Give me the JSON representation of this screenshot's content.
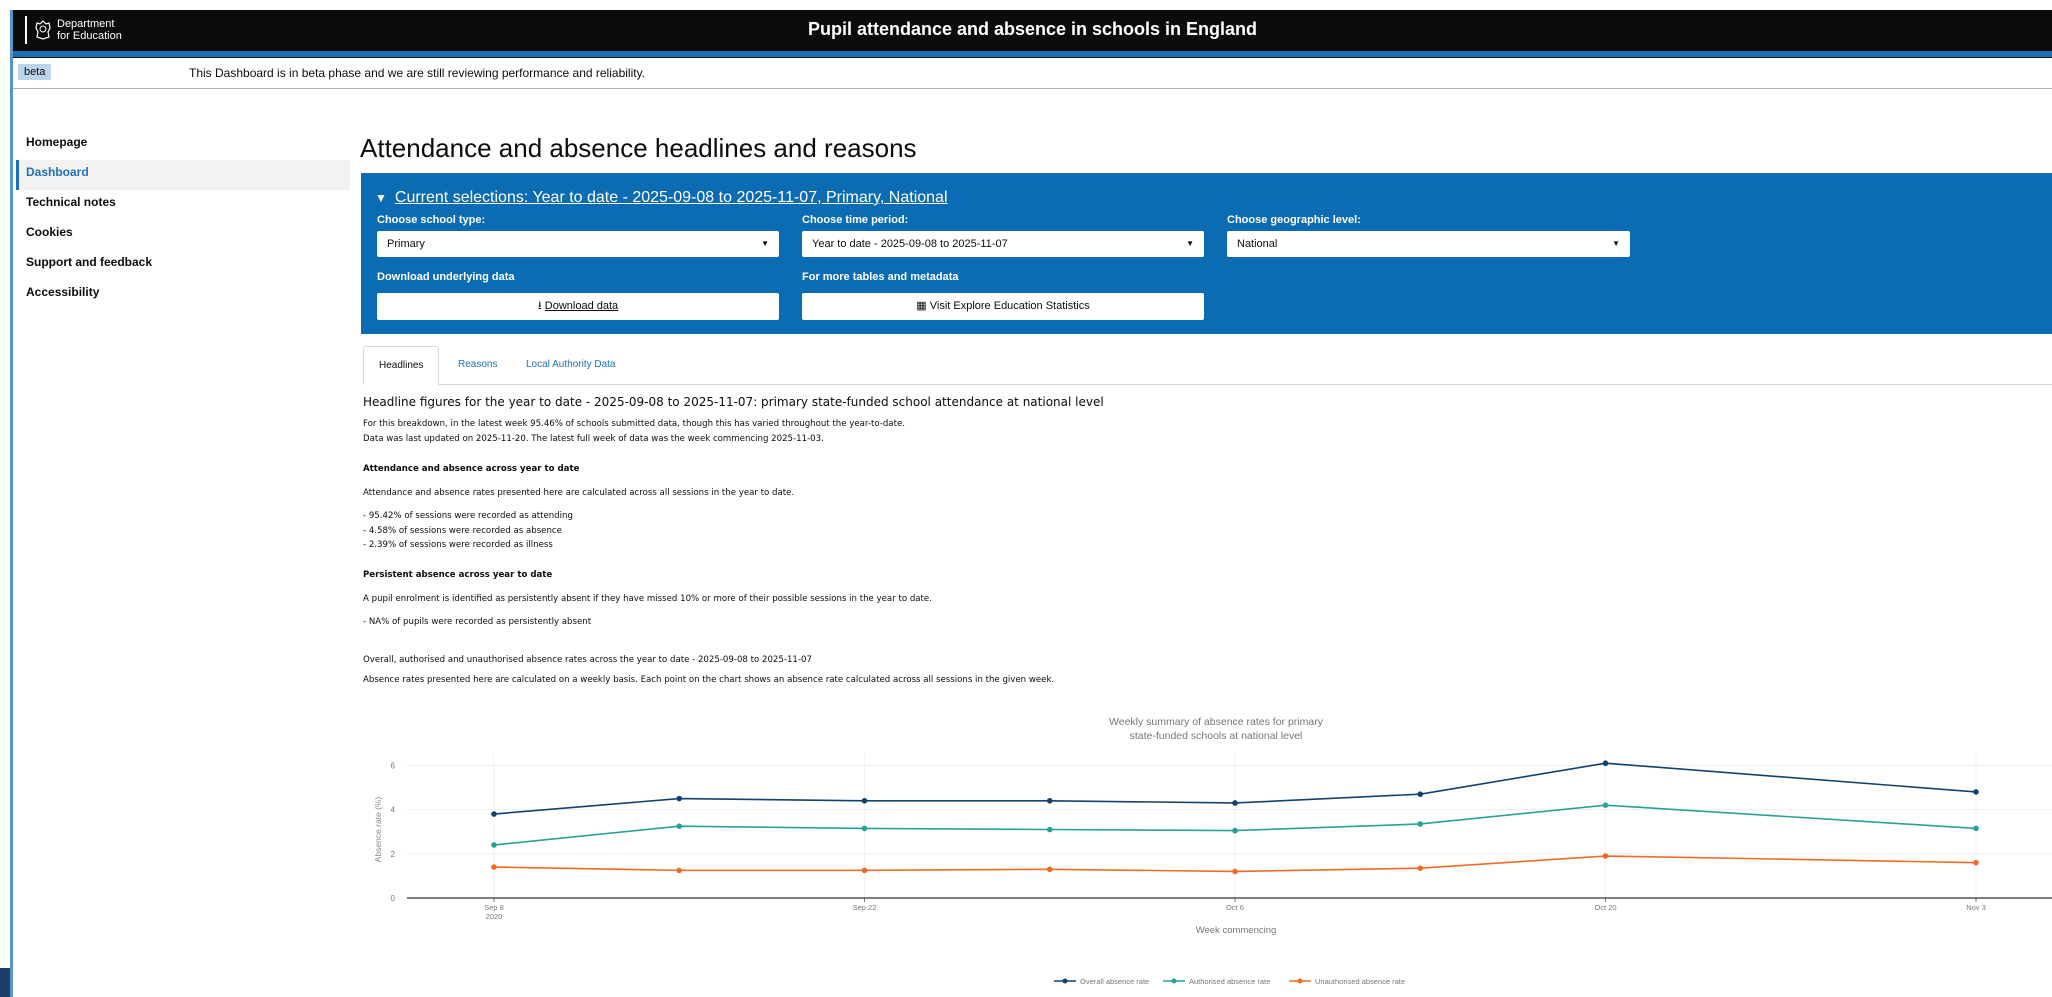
{
  "header": {
    "logo_line1": "Department",
    "logo_line2": "for Education",
    "title": "Pupil attendance and absence in schools in England"
  },
  "beta": {
    "tag": "beta",
    "message": "This Dashboard is in beta phase and we are still reviewing performance and reliability."
  },
  "nav": {
    "items": [
      {
        "label": "Homepage"
      },
      {
        "label": "Dashboard",
        "active": true
      },
      {
        "label": "Technical notes"
      },
      {
        "label": "Cookies"
      },
      {
        "label": "Support and feedback"
      },
      {
        "label": "Accessibility"
      }
    ]
  },
  "page": {
    "title": "Attendance and absence headlines and reasons"
  },
  "selections": {
    "summary": "Current selections: Year to date - 2025-09-08 to 2025-11-07, Primary, National",
    "school_type_label": "Choose school type:",
    "school_type_value": "Primary",
    "time_period_label": "Choose time period:",
    "time_period_value": "Year to date - 2025-09-08 to 2025-11-07",
    "geo_level_label": "Choose geographic level:",
    "geo_level_value": "National",
    "download_label": "Download underlying data",
    "download_button": "Download data",
    "more_tables_label": "For more tables and metadata",
    "explore_button": "Visit Explore Education Statistics",
    "accent_color": "#0b6cb4"
  },
  "tabs": [
    {
      "label": "Headlines",
      "active": true
    },
    {
      "label": "Reasons"
    },
    {
      "label": "Local Authority Data"
    }
  ],
  "headlines": {
    "heading": "Headline figures for the year to date - 2025-09-08 to 2025-11-07: primary state-funded school attendance at national level",
    "breakdown_note": "For this breakdown, in the latest week 95.46% of schools submitted data, though this has varied throughout the year-to-date.",
    "updated_note": "Data was last updated on 2025-11-20. The latest full week of data was the week commencing 2025-11-03.",
    "attendance_heading": "Attendance and absence across year to date",
    "attendance_desc": "Attendance and absence rates presented here are calculated across all sessions in the year to date.",
    "attending": "- 95.42% of sessions were recorded as attending",
    "absence": "- 4.58% of sessions were recorded as absence",
    "illness": "- 2.39% of sessions were recorded as illness",
    "persistent_heading": "Persistent absence across year to date",
    "persistent_desc": "A pupil enrolment is identified as persistently absent if they have missed 10% or more of their possible sessions in the year to date.",
    "persistent_value": "- NA% of pupils were recorded as persistently absent",
    "rates_heading": "Overall, authorised and unauthorised absence rates across the year to date - 2025-09-08 to 2025-11-07",
    "rates_desc": "Absence rates presented here are calculated on a weekly basis. Each point on the chart shows an absence rate calculated across all sessions in the given week."
  },
  "chart_data": {
    "type": "line",
    "title_line1": "Weekly summary of absence rates for primary",
    "title_line2": "state-funded schools at national level",
    "xlabel": "Week commencing",
    "ylabel": "Absence rate (%)",
    "x": [
      "2025-09-08",
      "2025-09-15",
      "2025-09-22",
      "2025-09-29",
      "2025-10-06",
      "2025-10-13",
      "2025-10-20",
      "2025-11-03"
    ],
    "x_ticks": [
      "Sep 8",
      "Sep 22",
      "Oct 6",
      "Oct 20",
      "Nov 3"
    ],
    "x_tick_dates": [
      "2025-09-08",
      "2025-09-22",
      "2025-10-06",
      "2025-10-20",
      "2025-11-03"
    ],
    "x_tick_sub": "2020",
    "y_ticks": [
      "0",
      "2",
      "4",
      "6"
    ],
    "ylim": [
      0,
      6.2
    ],
    "grid": true,
    "legend_position": "bottom",
    "series": [
      {
        "name": "Overall absence rate",
        "color": "#12436d",
        "values": [
          3.8,
          4.5,
          4.4,
          4.4,
          4.3,
          4.7,
          6.1,
          4.8
        ]
      },
      {
        "name": "Authorised absence rate",
        "color": "#28a197",
        "values": [
          2.4,
          3.25,
          3.15,
          3.1,
          3.05,
          3.35,
          4.2,
          3.15
        ]
      },
      {
        "name": "Unauthorised absence rate",
        "color": "#f46a25",
        "values": [
          1.4,
          1.25,
          1.25,
          1.3,
          1.2,
          1.35,
          1.9,
          1.6
        ]
      }
    ]
  }
}
